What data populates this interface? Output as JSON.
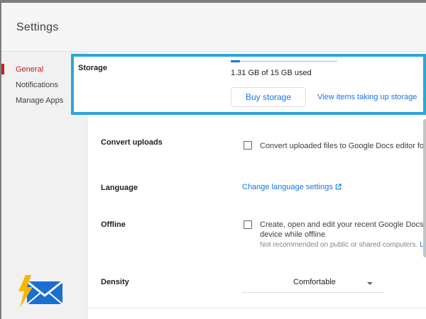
{
  "dialog": {
    "title": "Settings"
  },
  "sidebar": {
    "items": [
      {
        "label": "General",
        "active": true
      },
      {
        "label": "Notifications",
        "active": false
      },
      {
        "label": "Manage Apps",
        "active": false
      }
    ]
  },
  "storage": {
    "label": "Storage",
    "used_text": "1.31 GB of 15 GB used",
    "used_fraction": 0.087,
    "buy_button": "Buy storage",
    "view_items_link": "View items taking up storage"
  },
  "convert_uploads": {
    "label": "Convert uploads",
    "checkbox_text": "Convert uploaded files to Google Docs editor format",
    "checked": false
  },
  "language": {
    "label": "Language",
    "link": "Change language settings",
    "icon": "external-link-icon"
  },
  "offline": {
    "label": "Offline",
    "checkbox_line1": "Create, open and edit your recent Google Docs, Sheets",
    "checkbox_line2": "device while offline",
    "note": "Not recommended on public or shared computers.",
    "note_link": "Learn",
    "checked": false
  },
  "density": {
    "label": "Density",
    "selected": "Comfortable"
  },
  "colors": {
    "accent": "#1a73e8",
    "active_nav": "#c5221f",
    "highlight_border": "#2aa6dc"
  },
  "logo": {
    "icon": "lightning-mail-logo-icon"
  }
}
